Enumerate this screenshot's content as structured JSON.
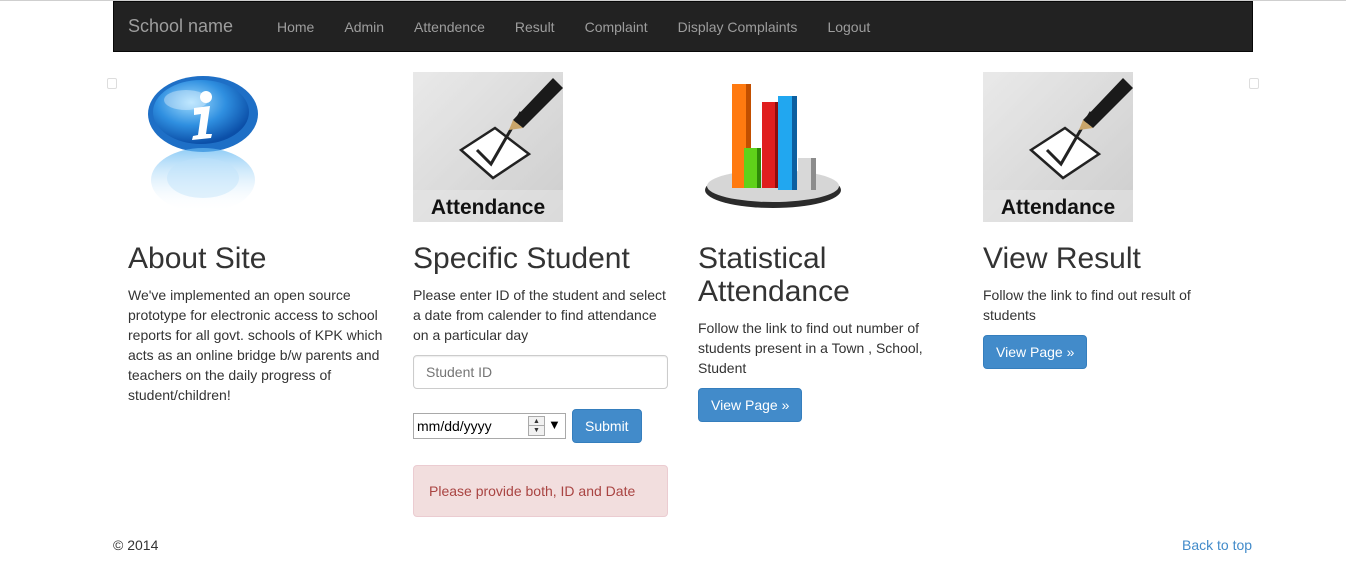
{
  "nav": {
    "brand": "School name",
    "links": [
      "Home",
      "Admin",
      "Attendence",
      "Result",
      "Complaint",
      "Display Complaints",
      "Logout"
    ]
  },
  "columns": {
    "about": {
      "title": "About Site",
      "text": "We've implemented an open source prototype for electronic access to school reports for all govt. schools of KPK which acts as an online bridge b/w parents and teachers on the daily progress of student/children!"
    },
    "specific": {
      "image_caption": "Attendance",
      "title": "Specific Student",
      "text": "Please enter ID of the student and select a date from calender to find attendance on a particular day",
      "id_placeholder": "Student ID",
      "date_placeholder": "mm/dd/yyyy",
      "submit_label": "Submit",
      "alert": "Please provide both, ID and Date"
    },
    "statistical": {
      "title": "Statistical Attendance",
      "text": "Follow the link to find out number of students present in a Town , School, Student",
      "button": "View Page »"
    },
    "result": {
      "image_caption": "Attendance",
      "title": "View Result",
      "text": "Follow the link to find out result of students",
      "button": "View Page »"
    }
  },
  "footer": {
    "copyright": "© 2014",
    "back_to_top": "Back to top"
  },
  "colors": {
    "navbar": "#222222",
    "primary": "#428bca",
    "alert_bg": "#f2dede",
    "alert_text": "#a94442"
  }
}
